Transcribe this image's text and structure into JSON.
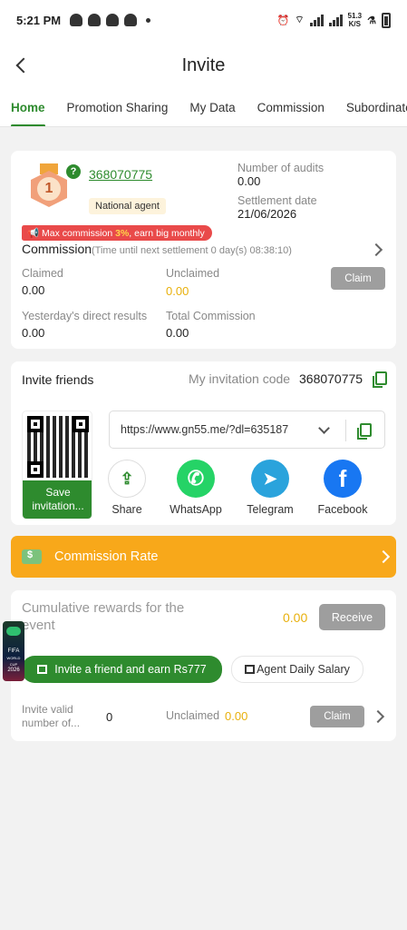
{
  "status": {
    "time": "5:21 PM",
    "net_speed_value": "51.3",
    "net_speed_unit": "K/S"
  },
  "header": {
    "title": "Invite"
  },
  "tabs": [
    {
      "label": "Home",
      "active": true
    },
    {
      "label": "Promotion Sharing"
    },
    {
      "label": "My Data"
    },
    {
      "label": "Commission"
    },
    {
      "label": "Subordinate"
    }
  ],
  "agent": {
    "level": "1",
    "id": "368070775",
    "badge": "National agent",
    "audits_label": "Number of audits",
    "audits_value": "0.00",
    "settlement_label": "Settlement date",
    "settlement_value": "21/06/2026",
    "max_commission_prefix": "Max commission ",
    "max_commission_value": "3%",
    "max_commission_suffix": ", earn big monthly",
    "commission_title": "Commission",
    "commission_note": "(Time until next settlement  0 day(s) 08:38:10)",
    "claimed_label": "Claimed",
    "claimed_value": "0.00",
    "unclaimed_label": "Unclaimed",
    "unclaimed_value": "0.00",
    "claim_button": "Claim",
    "yesterday_label": "Yesterday's direct results",
    "yesterday_value": "0.00",
    "total_label": "Total Commission",
    "total_value": "0.00"
  },
  "invite": {
    "title": "Invite friends",
    "code_label": "My invitation code",
    "code_value": "368070775",
    "save_label": "Save invitation...",
    "link": "https://www.gn55.me/?dl=635187",
    "share": [
      {
        "label": "Share",
        "icon": "share-icon",
        "color": "#ffffff"
      },
      {
        "label": "WhatsApp",
        "icon": "whatsapp-icon",
        "color": "#25d366"
      },
      {
        "label": "Telegram",
        "icon": "telegram-icon",
        "color": "#2aa3dc"
      },
      {
        "label": "Facebook",
        "icon": "facebook-icon",
        "color": "#1877f2"
      }
    ]
  },
  "commission_rate": {
    "label": "Commission Rate",
    "color": "#f8a81a"
  },
  "rewards": {
    "title": "Cumulative rewards for the event",
    "value": "0.00",
    "receive_button": "Receive",
    "invite_button": "Invite a friend and earn Rs777",
    "salary_button": "Agent Daily Salary",
    "valid_label": "Invite valid number of...",
    "valid_value": "0",
    "unclaimed_label": "Unclaimed",
    "unclaimed_value": "0.00",
    "claim_button": "Claim"
  },
  "fifa": {
    "text_1": "FIFA",
    "text_2": "WORLD CUP",
    "text_3": "2026"
  },
  "colors": {
    "brand": "#2e8b2e",
    "accent": "#f8a81a",
    "highlight": "#e8b00c",
    "alert": "#e94a4a"
  }
}
